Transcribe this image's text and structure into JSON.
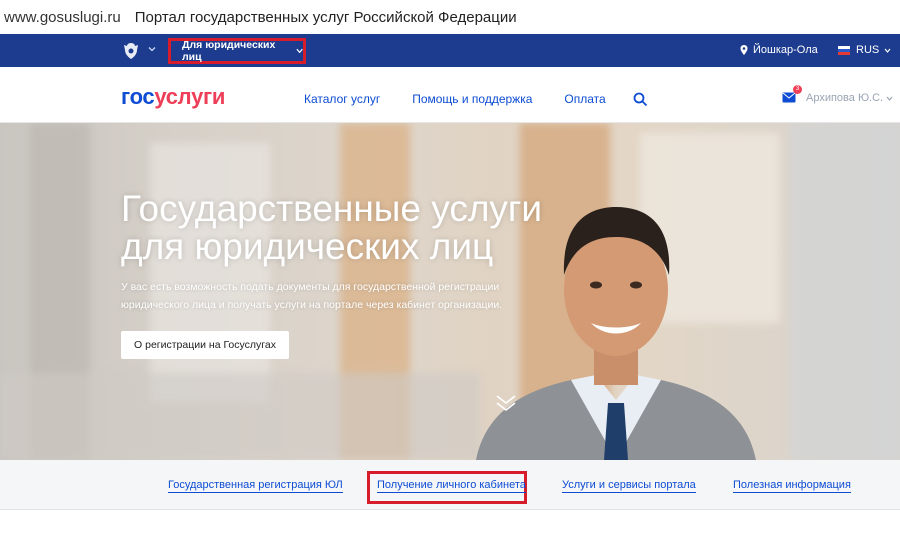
{
  "browser": {
    "url": "www.gosuslugi.ru",
    "page_title": "Портал государственных услуг Российской Федерации"
  },
  "topbar": {
    "audience_label": "Для юридических лиц",
    "location": "Йошкар-Ола",
    "language": "RUS"
  },
  "header": {
    "logo_part1": "гос",
    "logo_part2": "услуги",
    "nav": [
      {
        "label": "Каталог услуг"
      },
      {
        "label": "Помощь и поддержка"
      },
      {
        "label": "Оплата"
      }
    ],
    "mail_count": "3",
    "user_name": "Архипова Ю.С."
  },
  "hero": {
    "title": "Государственные услуги для юридических лиц",
    "subtitle": "У вас есть возможность подать документы для государственной регистрации юридического лица и получать услуги на портале через кабинет организации.",
    "button_label": "О регистрации на Госуслугах"
  },
  "tabs": [
    {
      "label": "Государственная регистрация ЮЛ"
    },
    {
      "label": "Получение личного кабинета"
    },
    {
      "label": "Услуги и сервисы портала"
    },
    {
      "label": "Полезная информация"
    }
  ],
  "colors": {
    "topbar": "#1d3c8f",
    "brand_blue": "#0d4cd3",
    "brand_red": "#ee3f58",
    "highlight_red": "#d71c2c"
  }
}
